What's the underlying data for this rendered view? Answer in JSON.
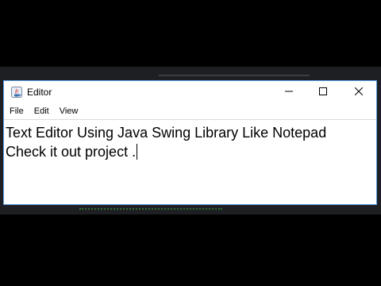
{
  "window": {
    "title": "Editor"
  },
  "menu": {
    "items": [
      "File",
      "Edit",
      "View"
    ]
  },
  "editor": {
    "lines": [
      "Text Editor Using Java Swing Library Like Notepad",
      "Check it out project ."
    ]
  },
  "icons": {
    "app": "java-app-icon",
    "minimize": "minimize-icon",
    "maximize": "maximize-icon",
    "close": "close-icon"
  },
  "colors": {
    "window_border": "#5aa0e6",
    "background": "#000000",
    "ide_background": "#1e1f22"
  }
}
